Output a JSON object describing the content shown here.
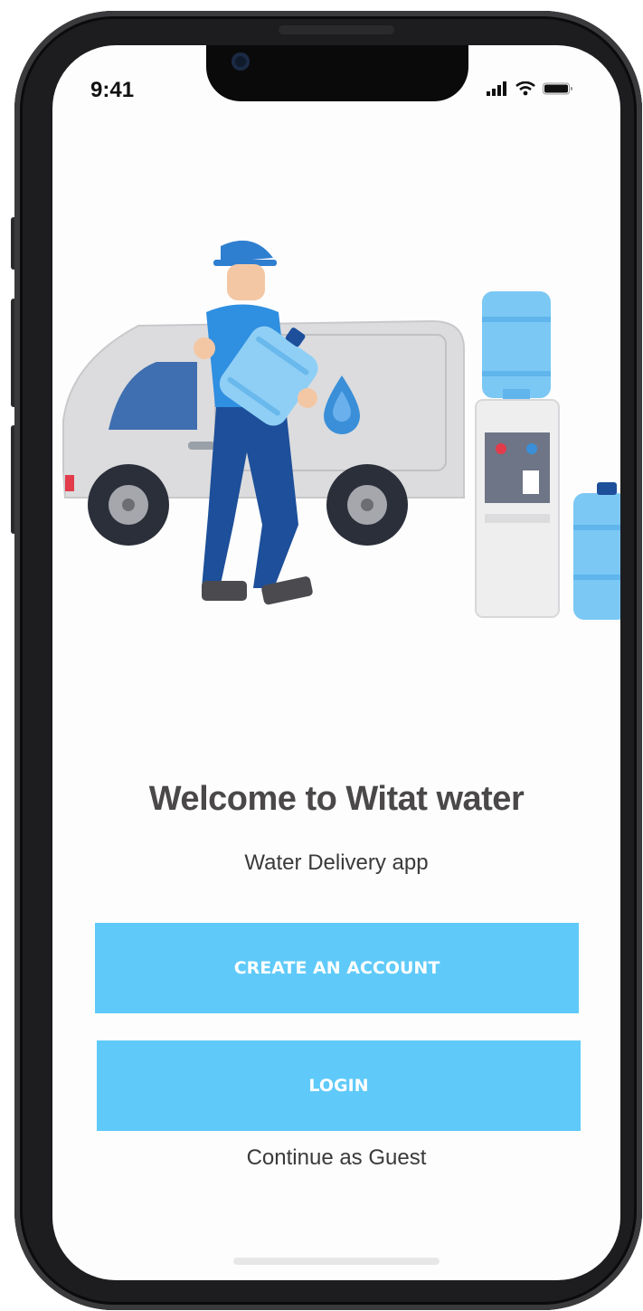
{
  "status_bar": {
    "time": "9:41",
    "signal_icon": "cellular-signal-icon",
    "wifi_icon": "wifi-icon",
    "battery_icon": "battery-icon"
  },
  "illustration": {
    "subject": "water-delivery-illustration"
  },
  "welcome": {
    "title": "Welcome to Witat water",
    "subtitle": "Water Delivery app"
  },
  "actions": {
    "create_account_label": "CREATE AN ACCOUNT",
    "login_label": "LOGIN",
    "guest_label": "Continue as Guest"
  },
  "colors": {
    "button_bg": "#5fcaf9",
    "button_text": "#ffffff",
    "title_text": "#4a4848"
  }
}
